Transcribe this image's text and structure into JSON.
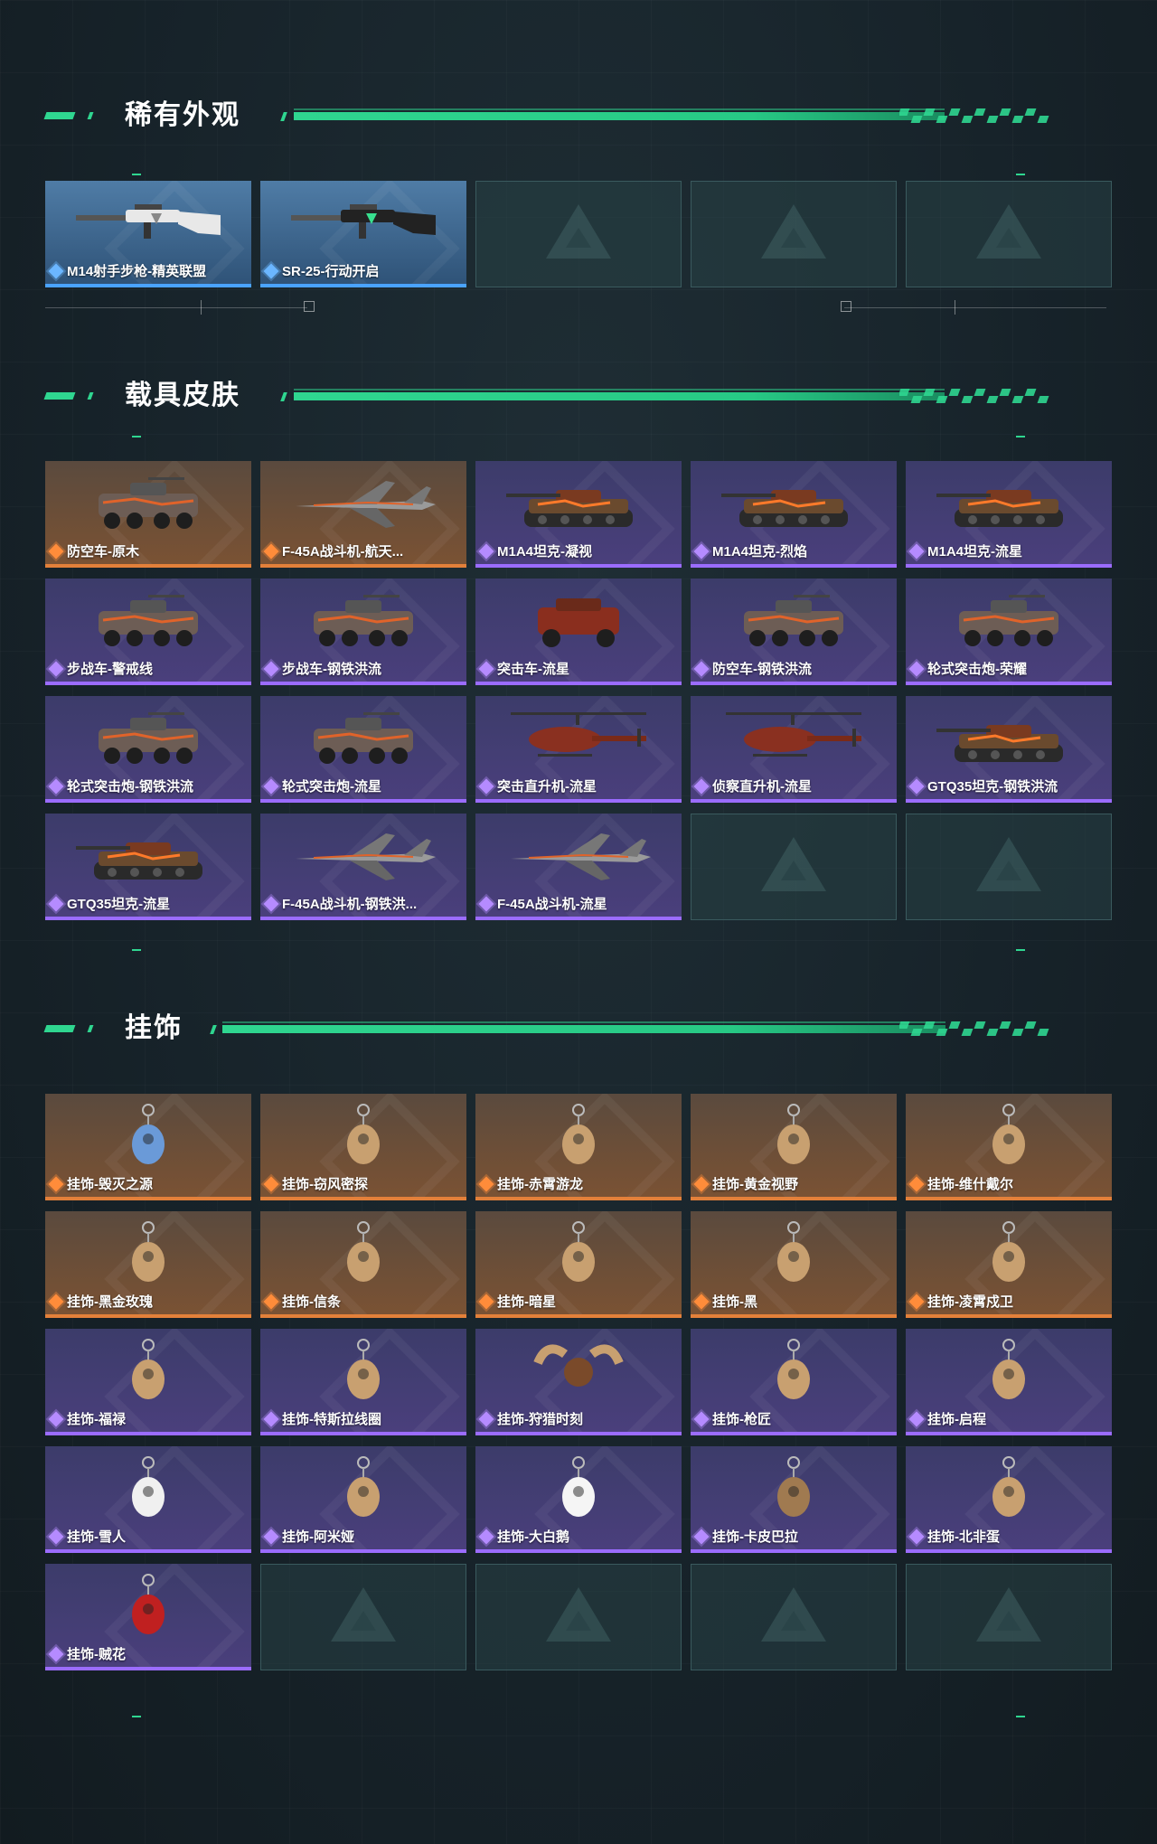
{
  "sections": {
    "rare": {
      "title": "稀有外观",
      "items": [
        {
          "label": "M14射手步枪-精英联盟",
          "rarity": "blue",
          "icon": "rifle-white-icon"
        },
        {
          "label": "SR-25-行动开启",
          "rarity": "blue",
          "icon": "rifle-black-green-icon"
        }
      ],
      "empty_slots": 3
    },
    "vehicles": {
      "title": "载具皮肤",
      "items": [
        {
          "label": "防空车-原木",
          "rarity": "orange",
          "icon": "apc-icon"
        },
        {
          "label": "F-45A战斗机-航天...",
          "rarity": "orange",
          "icon": "fighter-jet-icon"
        },
        {
          "label": "M1A4坦克-凝视",
          "rarity": "purple",
          "icon": "tank-icon"
        },
        {
          "label": "M1A4坦克-烈焰",
          "rarity": "purple",
          "icon": "tank-icon"
        },
        {
          "label": "M1A4坦克-流星",
          "rarity": "purple",
          "icon": "tank-icon"
        },
        {
          "label": "步战车-警戒线",
          "rarity": "purple",
          "icon": "apc-icon"
        },
        {
          "label": "步战车-钢铁洪流",
          "rarity": "purple",
          "icon": "apc-icon"
        },
        {
          "label": "突击车-流星",
          "rarity": "purple",
          "icon": "assault-vehicle-icon"
        },
        {
          "label": "防空车-钢铁洪流",
          "rarity": "purple",
          "icon": "apc-icon"
        },
        {
          "label": "轮式突击炮-荣耀",
          "rarity": "purple",
          "icon": "armored-car-icon"
        },
        {
          "label": "轮式突击炮-钢铁洪流",
          "rarity": "purple",
          "icon": "armored-car-icon"
        },
        {
          "label": "轮式突击炮-流星",
          "rarity": "purple",
          "icon": "armored-car-icon"
        },
        {
          "label": "突击直升机-流星",
          "rarity": "purple",
          "icon": "helicopter-icon"
        },
        {
          "label": "侦察直升机-流星",
          "rarity": "purple",
          "icon": "helicopter-icon"
        },
        {
          "label": "GTQ35坦克-钢铁洪流",
          "rarity": "purple",
          "icon": "tank-icon"
        },
        {
          "label": "GTQ35坦克-流星",
          "rarity": "purple",
          "icon": "tank-icon"
        },
        {
          "label": "F-45A战斗机-钢铁洪...",
          "rarity": "purple",
          "icon": "fighter-jet-icon"
        },
        {
          "label": "F-45A战斗机-流星",
          "rarity": "purple",
          "icon": "fighter-jet-icon"
        }
      ],
      "empty_slots": 2
    },
    "charms": {
      "title": "挂饰",
      "items": [
        {
          "label": "挂饰-毁灭之源",
          "rarity": "orange",
          "icon": "dragon-charm-icon"
        },
        {
          "label": "挂饰-窃风密探",
          "rarity": "orange",
          "icon": "charm-icon"
        },
        {
          "label": "挂饰-赤霄游龙",
          "rarity": "orange",
          "icon": "charm-icon"
        },
        {
          "label": "挂饰-黄金视野",
          "rarity": "orange",
          "icon": "charm-icon"
        },
        {
          "label": "挂饰-维什戴尔",
          "rarity": "orange",
          "icon": "charm-icon"
        },
        {
          "label": "挂饰-黑金玫瑰",
          "rarity": "orange",
          "icon": "charm-icon"
        },
        {
          "label": "挂饰-信条",
          "rarity": "orange",
          "icon": "charm-icon"
        },
        {
          "label": "挂饰-暗星",
          "rarity": "orange",
          "icon": "charm-icon"
        },
        {
          "label": "挂饰-黑",
          "rarity": "orange",
          "icon": "charm-icon"
        },
        {
          "label": "挂饰-凌霄戍卫",
          "rarity": "orange",
          "icon": "charm-icon"
        },
        {
          "label": "挂饰-福禄",
          "rarity": "purple",
          "icon": "charm-icon"
        },
        {
          "label": "挂饰-特斯拉线圈",
          "rarity": "purple",
          "icon": "charm-icon"
        },
        {
          "label": "挂饰-狩猎时刻",
          "rarity": "purple",
          "icon": "antler-charm-icon"
        },
        {
          "label": "挂饰-枪匠",
          "rarity": "purple",
          "icon": "charm-icon"
        },
        {
          "label": "挂饰-启程",
          "rarity": "purple",
          "icon": "charm-icon"
        },
        {
          "label": "挂饰-雪人",
          "rarity": "purple",
          "icon": "snowman-charm-icon"
        },
        {
          "label": "挂饰-阿米娅",
          "rarity": "purple",
          "icon": "charm-icon"
        },
        {
          "label": "挂饰-大白鹅",
          "rarity": "purple",
          "icon": "goose-charm-icon"
        },
        {
          "label": "挂饰-卡皮巴拉",
          "rarity": "purple",
          "icon": "capybara-charm-icon"
        },
        {
          "label": "挂饰-北非蛋",
          "rarity": "purple",
          "icon": "charm-icon"
        },
        {
          "label": "挂饰-贼花",
          "rarity": "purple",
          "icon": "flower-charm-icon"
        }
      ],
      "empty_slots": 4
    }
  },
  "colors": {
    "accent": "#2fd690",
    "rarity_blue": "#4aa3ff",
    "rarity_orange": "#e3803a",
    "rarity_purple": "#9b6cff"
  }
}
